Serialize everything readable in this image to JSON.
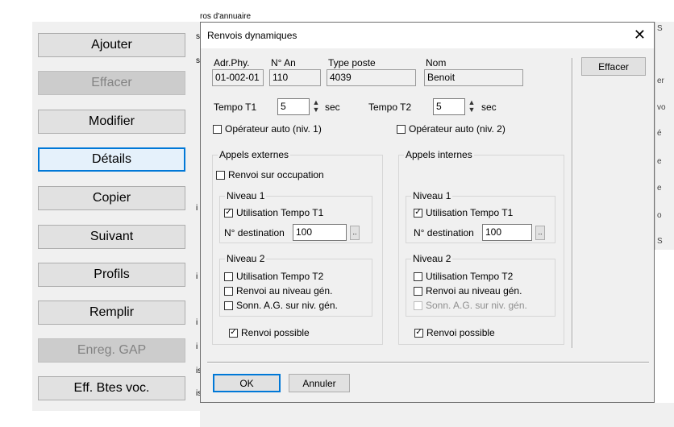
{
  "left_buttons": [
    {
      "label": "Ajouter",
      "state": "normal"
    },
    {
      "label": "Effacer",
      "state": "disabled"
    },
    {
      "label": "Modifier",
      "state": "normal"
    },
    {
      "label": "Détails",
      "state": "focused"
    },
    {
      "label": "Copier",
      "state": "normal"
    },
    {
      "label": "Suivant",
      "state": "normal"
    },
    {
      "label": "Profils",
      "state": "normal"
    },
    {
      "label": "Remplir",
      "state": "normal"
    },
    {
      "label": "Enreg. GAP",
      "state": "disabled"
    },
    {
      "label": "Eff. Btes voc.",
      "state": "normal"
    }
  ],
  "background": {
    "top_text": "ros d'annuaire",
    "left_fragments": [
      "s",
      "s",
      "",
      "",
      "",
      "",
      "i",
      "",
      "i",
      "i",
      "i",
      "is",
      "is"
    ],
    "right_fragments": [
      "S",
      "",
      "er",
      "vo",
      "é",
      "e",
      "e",
      "o",
      "S"
    ]
  },
  "dialog": {
    "title": "Renvois dynamiques",
    "close": "✕",
    "fields": {
      "adr_phy": {
        "label": "Adr.Phy.",
        "value": "01-002-01"
      },
      "n_an": {
        "label": "N° An",
        "value": "110"
      },
      "type_poste": {
        "label": "Type poste",
        "value": "4039"
      },
      "nom": {
        "label": "Nom",
        "value": "Benoit"
      }
    },
    "effacer_label": "Effacer",
    "tempo_t1": {
      "label": "Tempo T1",
      "value": "5",
      "unit": "sec"
    },
    "tempo_t2": {
      "label": "Tempo T2",
      "value": "5",
      "unit": "sec"
    },
    "operateur_auto_1": {
      "label": "Opérateur auto (niv. 1)",
      "checked": false
    },
    "operateur_auto_2": {
      "label": "Opérateur auto (niv. 2)",
      "checked": false
    },
    "externes": {
      "title": "Appels externes",
      "renvoi_occupation": "Renvoi sur occupation",
      "niveau1": {
        "title": "Niveau 1",
        "tempo": "Utilisation Tempo T1",
        "dest_label": "N° destination",
        "dest_value": "100",
        "browse": ".."
      },
      "niveau2": {
        "title": "Niveau 2",
        "tempo": "Utilisation Tempo T2",
        "renvoi_gen": "Renvoi au niveau gén.",
        "sonn": "Sonn. A.G. sur niv. gén."
      },
      "renvoi_possible": "Renvoi possible"
    },
    "internes": {
      "title": "Appels internes",
      "niveau1": {
        "title": "Niveau 1",
        "tempo": "Utilisation Tempo T1",
        "dest_label": "N° destination",
        "dest_value": "100",
        "browse": ".."
      },
      "niveau2": {
        "title": "Niveau 2",
        "tempo": "Utilisation Tempo T2",
        "renvoi_gen": "Renvoi au niveau gén.",
        "sonn": "Sonn. A.G. sur niv. gén."
      },
      "renvoi_possible": "Renvoi possible"
    },
    "ok_label": "OK",
    "cancel_label": "Annuler",
    "check_mark": "✓",
    "spin_up": "▲",
    "spin_down": "▼"
  }
}
